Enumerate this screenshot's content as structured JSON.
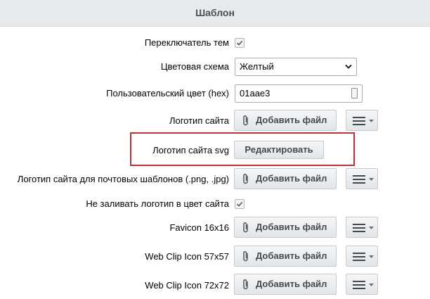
{
  "header": {
    "title": "Шаблон"
  },
  "rows": {
    "theme_switcher": {
      "label": "Переключатель тем",
      "checked": true
    },
    "color_scheme": {
      "label": "Цветовая схема",
      "value": "Желтый"
    },
    "custom_color": {
      "label": "Пользовательский цвет (hex)",
      "value": "01aae3"
    },
    "site_logo": {
      "label": "Логотип сайта",
      "button": "Добавить файл"
    },
    "site_logo_svg": {
      "label": "Логотип сайта svg",
      "button": "Редактировать"
    },
    "mail_logo": {
      "label": "Логотип сайта для почтовых шаблонов (.png, .jpg)",
      "button": "Добавить файл"
    },
    "no_fill_logo": {
      "label": "Не заливать логотип в цвет сайта",
      "checked": true
    },
    "favicon": {
      "label": "Favicon 16x16",
      "button": "Добавить файл"
    },
    "webclip_57": {
      "label": "Web Clip Icon 57x57",
      "button": "Добавить файл"
    },
    "webclip_72": {
      "label": "Web Clip Icon 72x72",
      "button": "Добавить файл"
    }
  },
  "colors": {
    "highlight_border": "#b73537",
    "header_bg": "#e7eaec",
    "button_text": "#434a50"
  },
  "icons": {
    "attach": "paperclip-icon",
    "menu": "menu-bars-icon",
    "dropdown": "chevron-down-icon",
    "check": "checkmark-icon"
  }
}
